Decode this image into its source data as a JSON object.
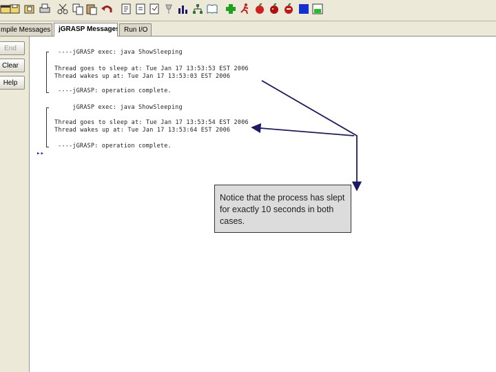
{
  "toolbar": {
    "icons": [
      "file-icon",
      "save-icon",
      "open-folder-icon",
      "print-icon",
      "cut-icon",
      "copy-icon",
      "paste-icon",
      "undo-icon",
      "generate-icon",
      "document-icon",
      "compile-icon",
      "pin-icon",
      "chart-icon",
      "tree-icon",
      "book-icon",
      "add-icon",
      "run-icon",
      "debug-icon",
      "step-icon",
      "stop-icon",
      "square-icon",
      "green-square-icon"
    ]
  },
  "tabs": {
    "compile_messages": "mpile Messages",
    "jgrasp_messages": "jGRASP Messages",
    "run_io": "Run I/O"
  },
  "side_buttons": {
    "end": "End",
    "clear": "Clear",
    "help": "Help"
  },
  "console": {
    "lines": [
      "----jGRASP exec: java ShowSleeping",
      "Thread goes to sleep at: Tue Jan 17 13:53:53 EST 2006",
      "Thread wakes up at: Tue Jan 17 13:53:03 EST 2006",
      "----jGRASP: operation complete.",
      "    jGRASP exec: java ShowSleeping",
      "Thread goes to sleep at: Tue Jan 17 13:53:54 EST 2006",
      "Thread wakes up at: Tue Jan 17 13:53:64 EST 2006",
      "----jGRASP: operation complete."
    ],
    "prompt": "▸▸"
  },
  "callout": {
    "text": "Notice that the process has slept for exactly 10 seconds in both cases."
  },
  "colors": {
    "arrow": "#1a1a66",
    "chrome": "#ece9d8"
  }
}
